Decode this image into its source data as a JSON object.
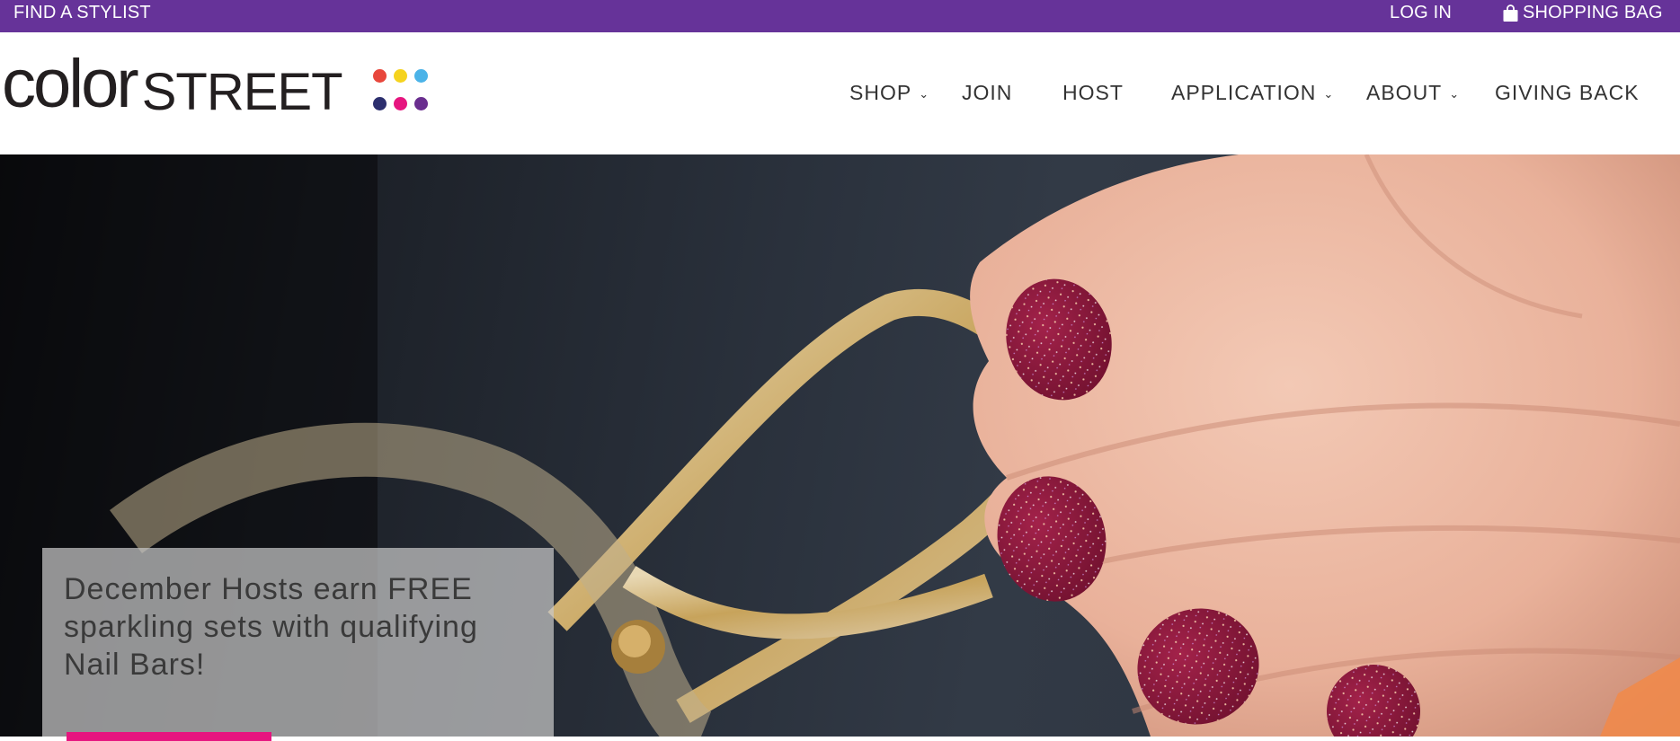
{
  "topbar": {
    "find_stylist": "FIND A STYLIST",
    "login": "LOG IN",
    "shopping_bag": "SHOPPING BAG",
    "background": "#663399"
  },
  "logo": {
    "color_text": "color",
    "street_text": "STREET",
    "dot_colors": [
      "#e8473c",
      "#f5d31f",
      "#4bb3e8",
      "#2c2f6e",
      "#e6157f",
      "#6a2e8f"
    ]
  },
  "nav": {
    "items": [
      {
        "label": "SHOP",
        "has_dropdown": true
      },
      {
        "label": "JOIN",
        "has_dropdown": false
      },
      {
        "label": "HOST",
        "has_dropdown": false
      },
      {
        "label": "APPLICATION",
        "has_dropdown": true
      },
      {
        "label": "ABOUT",
        "has_dropdown": true
      },
      {
        "label": "GIVING BACK",
        "has_dropdown": false
      }
    ],
    "caret": "⌄"
  },
  "hero": {
    "promo_text": "December Hosts earn FREE sparkling sets with qualifying Nail Bars!",
    "cta_color": "#e6157f"
  }
}
